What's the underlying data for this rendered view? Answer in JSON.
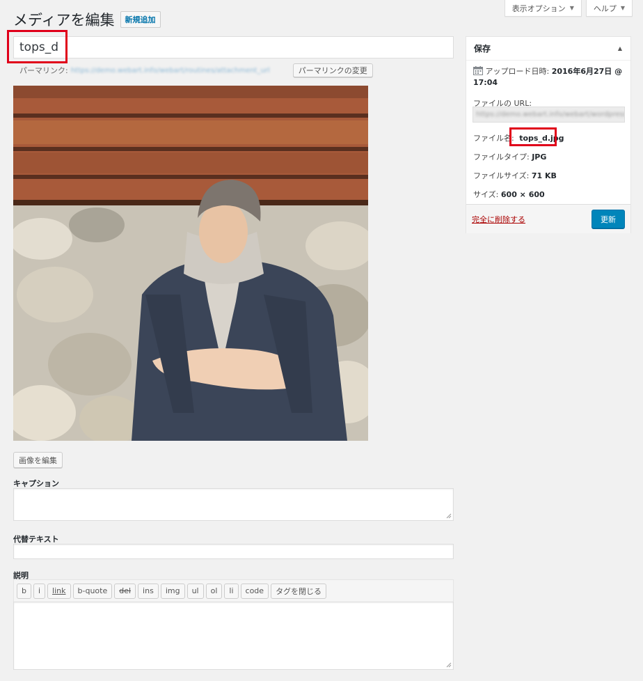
{
  "screen_meta": {
    "display_options": "表示オプション",
    "help": "ヘルプ"
  },
  "header": {
    "title": "メディアを編集",
    "add_new": "新規追加"
  },
  "post": {
    "title": "tops_d",
    "permalink_label": "パーマリンク:",
    "permalink_url": "https://demo.webart.info/webart/routines/attachment_url",
    "change_permalink": "パーマリンクの変更"
  },
  "image_actions": {
    "edit_image": "画像を編集"
  },
  "fields": {
    "caption_label": "キャプション",
    "caption_value": "",
    "alt_label": "代替テキスト",
    "alt_value": "",
    "description_label": "説明",
    "description_value": ""
  },
  "quicktags": [
    "b",
    "i",
    "link",
    "b-quote",
    "del",
    "ins",
    "img",
    "ul",
    "ol",
    "li",
    "code",
    "タグを閉じる"
  ],
  "save_box": {
    "title": "保存",
    "upload_label": "アップロード日時:",
    "upload_date": "2016年6月27日 @",
    "upload_time": "17:04",
    "file_url_label": "ファイルの URL:",
    "file_url": "https://demo.webart.info/webart/wordpress/tops_d.jpg",
    "file_name_label": "ファイル名:",
    "file_name": "tops_d.jpg",
    "file_type_label": "ファイルタイプ:",
    "file_type": "JPG",
    "file_size_label": "ファイルサイズ:",
    "file_size": "71 KB",
    "dimensions_label": "サイズ:",
    "dimensions": "600 × 600",
    "delete_link": "完全に削除する",
    "update_button": "更新"
  },
  "colors": {
    "highlight": "#e0001a",
    "primary": "#0085ba",
    "delete": "#aa0000"
  }
}
